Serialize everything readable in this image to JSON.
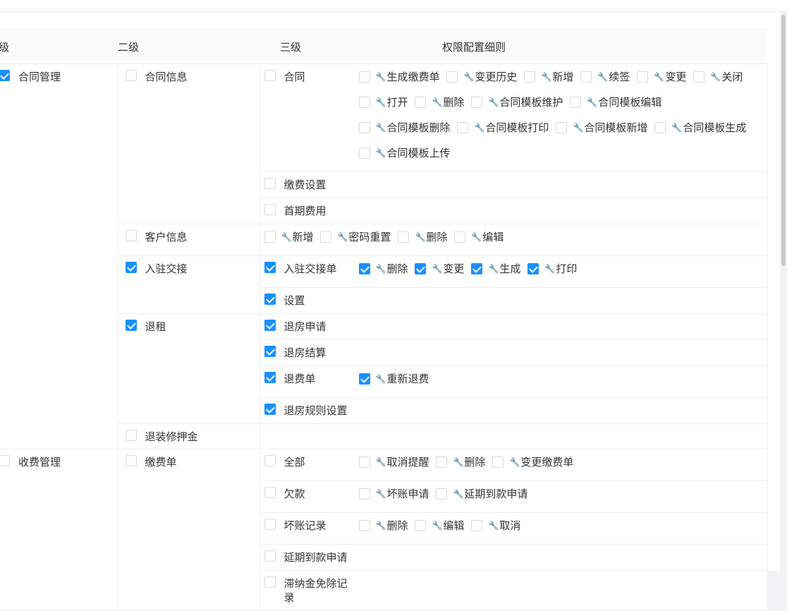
{
  "headers": {
    "level1": "级",
    "level2": "二级",
    "level3": "三级",
    "details": "权限配置细则"
  },
  "colors": {
    "checked": "#1890ff",
    "border": "#d9d9d9",
    "header_bg": "#fafafa"
  },
  "icons": {
    "permission_icon": "wrench-icon"
  },
  "groups": [
    {
      "name": "合同管理",
      "checked": true,
      "level2": [
        {
          "name": "合同信息",
          "checked": false,
          "level3": [
            {
              "name": "合同",
              "checked": false,
              "details": [
                {
                  "label": "生成缴费单",
                  "checked": false
                },
                {
                  "label": "变更历史",
                  "checked": false
                },
                {
                  "label": "新增",
                  "checked": false
                },
                {
                  "label": "续签",
                  "checked": false
                },
                {
                  "label": "变更",
                  "checked": false
                },
                {
                  "label": "关闭",
                  "checked": false
                },
                {
                  "label": "打开",
                  "checked": false
                },
                {
                  "label": "删除",
                  "checked": false
                },
                {
                  "label": "合同模板维护",
                  "checked": false
                },
                {
                  "label": "合同模板编辑",
                  "checked": false
                },
                {
                  "label": "合同模板删除",
                  "checked": false
                },
                {
                  "label": "合同模板打印",
                  "checked": false
                },
                {
                  "label": "合同模板新增",
                  "checked": false
                },
                {
                  "label": "合同模板生成",
                  "checked": false
                },
                {
                  "label": "合同模板上传",
                  "checked": false
                }
              ]
            },
            {
              "name": "缴费设置",
              "checked": false,
              "details": []
            },
            {
              "name": "首期费用",
              "checked": false,
              "details": []
            }
          ]
        },
        {
          "name": "客户信息",
          "checked": false,
          "direct_details": [
            {
              "label": "新增",
              "checked": false
            },
            {
              "label": "密码重置",
              "checked": false
            },
            {
              "label": "删除",
              "checked": false
            },
            {
              "label": "编辑",
              "checked": false
            }
          ]
        },
        {
          "name": "入驻交接",
          "checked": true,
          "level3": [
            {
              "name": "入驻交接单",
              "checked": true,
              "details": [
                {
                  "label": "删除",
                  "checked": true
                },
                {
                  "label": "变更",
                  "checked": true
                },
                {
                  "label": "生成",
                  "checked": true
                },
                {
                  "label": "打印",
                  "checked": true
                }
              ]
            },
            {
              "name": "设置",
              "checked": true,
              "details": []
            }
          ]
        },
        {
          "name": "退租",
          "checked": true,
          "level3": [
            {
              "name": "退房申请",
              "checked": true,
              "details": []
            },
            {
              "name": "退房结算",
              "checked": true,
              "details": []
            },
            {
              "name": "退费单",
              "checked": true,
              "details": [
                {
                  "label": "重新退费",
                  "checked": true
                }
              ]
            },
            {
              "name": "退房规则设置",
              "checked": true,
              "details": []
            }
          ]
        },
        {
          "name": "退装修押金",
          "checked": false,
          "direct_details": []
        }
      ]
    },
    {
      "name": "收费管理",
      "checked": false,
      "level2": [
        {
          "name": "缴费单",
          "checked": false,
          "level3": [
            {
              "name": "全部",
              "checked": false,
              "details": [
                {
                  "label": "取消提醒",
                  "checked": false
                },
                {
                  "label": "删除",
                  "checked": false
                },
                {
                  "label": "变更缴费单",
                  "checked": false
                }
              ]
            },
            {
              "name": "欠款",
              "checked": false,
              "details": [
                {
                  "label": "坏账申请",
                  "checked": false
                },
                {
                  "label": "延期到款申请",
                  "checked": false
                }
              ]
            },
            {
              "name": "坏账记录",
              "checked": false,
              "details": [
                {
                  "label": "删除",
                  "checked": false
                },
                {
                  "label": "编辑",
                  "checked": false
                },
                {
                  "label": "取消",
                  "checked": false
                }
              ]
            },
            {
              "name": "延期到款申请",
              "checked": false,
              "details": []
            },
            {
              "name": "滞纳金免除记录",
              "checked": false,
              "details": []
            }
          ]
        }
      ]
    }
  ]
}
